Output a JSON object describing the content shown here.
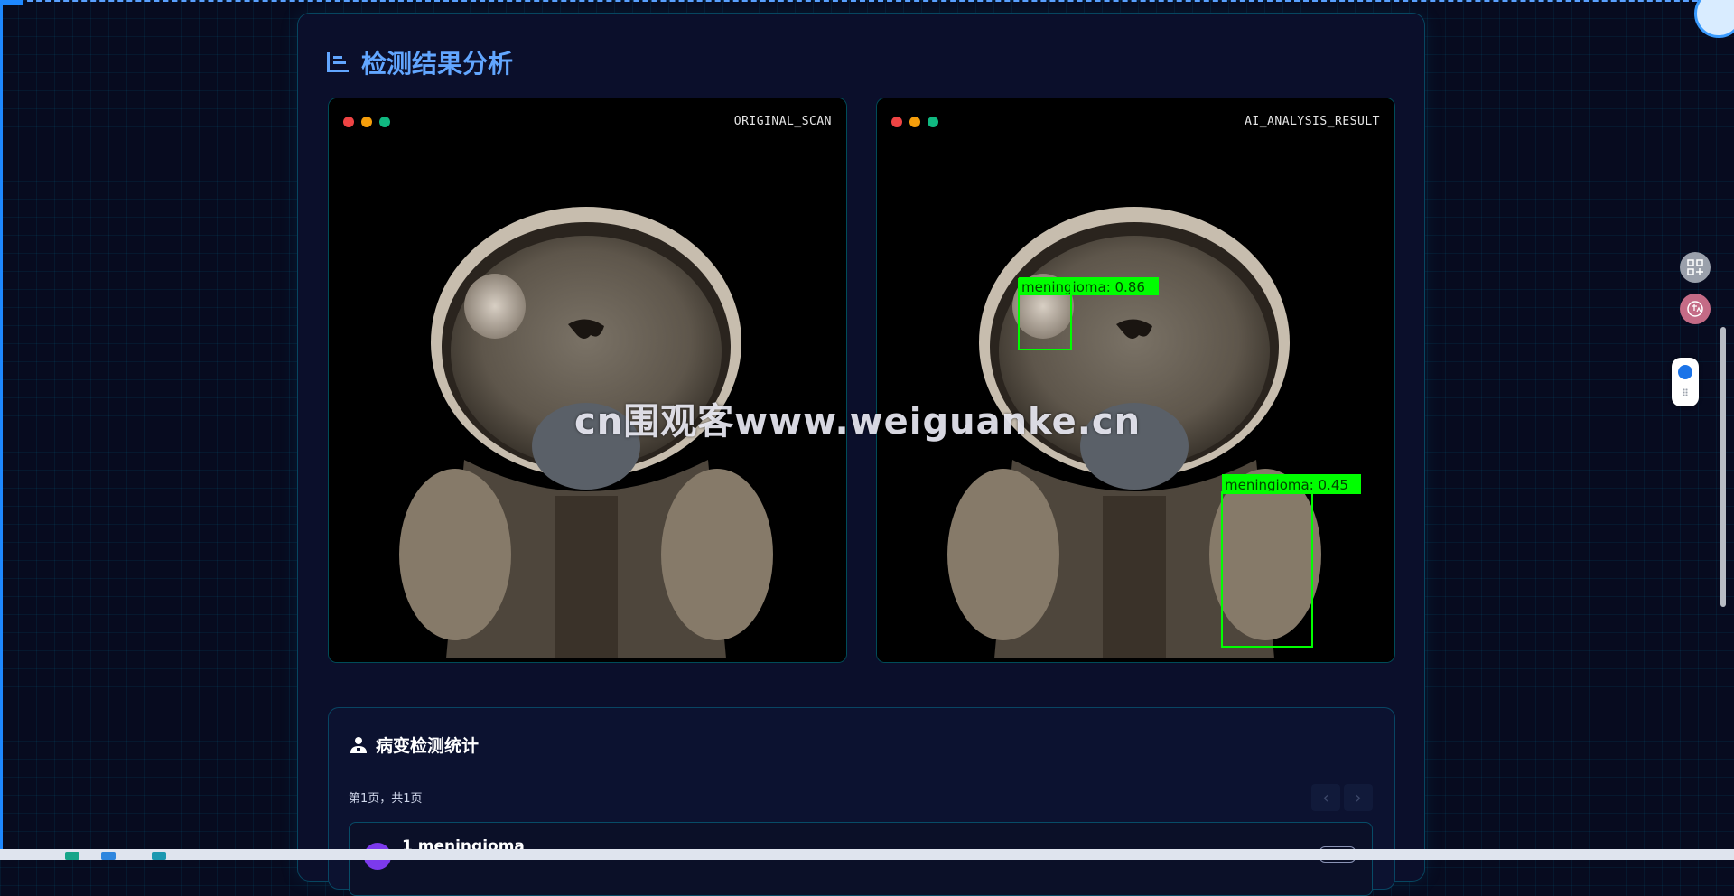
{
  "panel": {
    "title": "检测结果分析",
    "icon": "chart-bars-icon"
  },
  "viewers": {
    "original": {
      "label": "ORIGINAL_SCAN"
    },
    "analysis": {
      "label": "AI_ANALYSIS_RESULT",
      "detections": [
        {
          "label": "meningioma: 0.86",
          "class": "meningioma",
          "score": 0.86
        },
        {
          "label": "meningioma: 0.45",
          "class": "meningioma",
          "score": 0.45
        }
      ],
      "box_color": "#00ff00"
    }
  },
  "watermark": {
    "text": "cn围观客www.weiguanke.cn"
  },
  "stats": {
    "title": "病变检测统计",
    "icon": "doctor-icon",
    "page_info": "第1页，共1页",
    "prev_icon": "chevron-left-icon",
    "next_icon": "chevron-right-icon",
    "items": [
      {
        "title": "1 meningioma"
      }
    ]
  },
  "colors": {
    "accent": "#62a6ff",
    "panel_bg": "#0b0f2b",
    "border": "#00c8dc"
  }
}
